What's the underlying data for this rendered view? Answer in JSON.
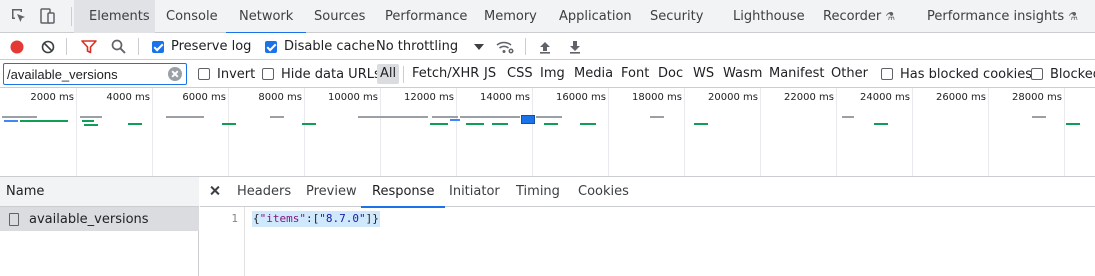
{
  "main_tabs": [
    {
      "label": "Elements"
    },
    {
      "label": "Console"
    },
    {
      "label": "Network"
    },
    {
      "label": "Sources"
    },
    {
      "label": "Performance"
    },
    {
      "label": "Memory"
    },
    {
      "label": "Application"
    },
    {
      "label": "Security"
    },
    {
      "label": "Lighthouse"
    },
    {
      "label": "Recorder"
    },
    {
      "label": "Performance insights"
    }
  ],
  "toolbar": {
    "preserve_log": "Preserve log",
    "disable_cache": "Disable cache",
    "throttling": "No throttling"
  },
  "filter": {
    "value": "/available_versions",
    "invert": "Invert",
    "hide_data_urls": "Hide data URLs",
    "types": [
      "All",
      "Fetch/XHR",
      "JS",
      "CSS",
      "Img",
      "Media",
      "Font",
      "Doc",
      "WS",
      "Wasm",
      "Manifest",
      "Other"
    ],
    "has_blocked_cookies": "Has blocked cookies",
    "blocked": "Blocked"
  },
  "overview": {
    "ticks": [
      "2000 ms",
      "4000 ms",
      "6000 ms",
      "8000 ms",
      "10000 ms",
      "12000 ms",
      "14000 ms",
      "16000 ms",
      "18000 ms",
      "20000 ms",
      "22000 ms",
      "24000 ms",
      "26000 ms",
      "28000 ms"
    ]
  },
  "requests": {
    "header": "Name",
    "items": [
      {
        "name": "available_versions"
      }
    ]
  },
  "detail": {
    "tabs": [
      {
        "label": "Headers"
      },
      {
        "label": "Preview"
      },
      {
        "label": "Response"
      },
      {
        "label": "Initiator"
      },
      {
        "label": "Timing"
      },
      {
        "label": "Cookies"
      }
    ],
    "line_number": "1",
    "response": {
      "open": "{",
      "key": "\"items\"",
      "colon": ":[",
      "value": "\"8.7.0\"",
      "close": "]}"
    }
  },
  "colors": {
    "accent": "#1a73e8",
    "record": "#e53935",
    "filter_funnel": "#d93025",
    "waterfall_green": "#0f9d58",
    "waterfall_gray": "#9aa0a6"
  },
  "icons": [
    "inspect-element-icon",
    "device-toolbar-icon",
    "flask-icon",
    "record-icon",
    "clear-icon",
    "filter-icon",
    "search-icon",
    "network-conditions-icon",
    "import-har-icon",
    "export-har-icon",
    "file-icon",
    "close-icon"
  ]
}
